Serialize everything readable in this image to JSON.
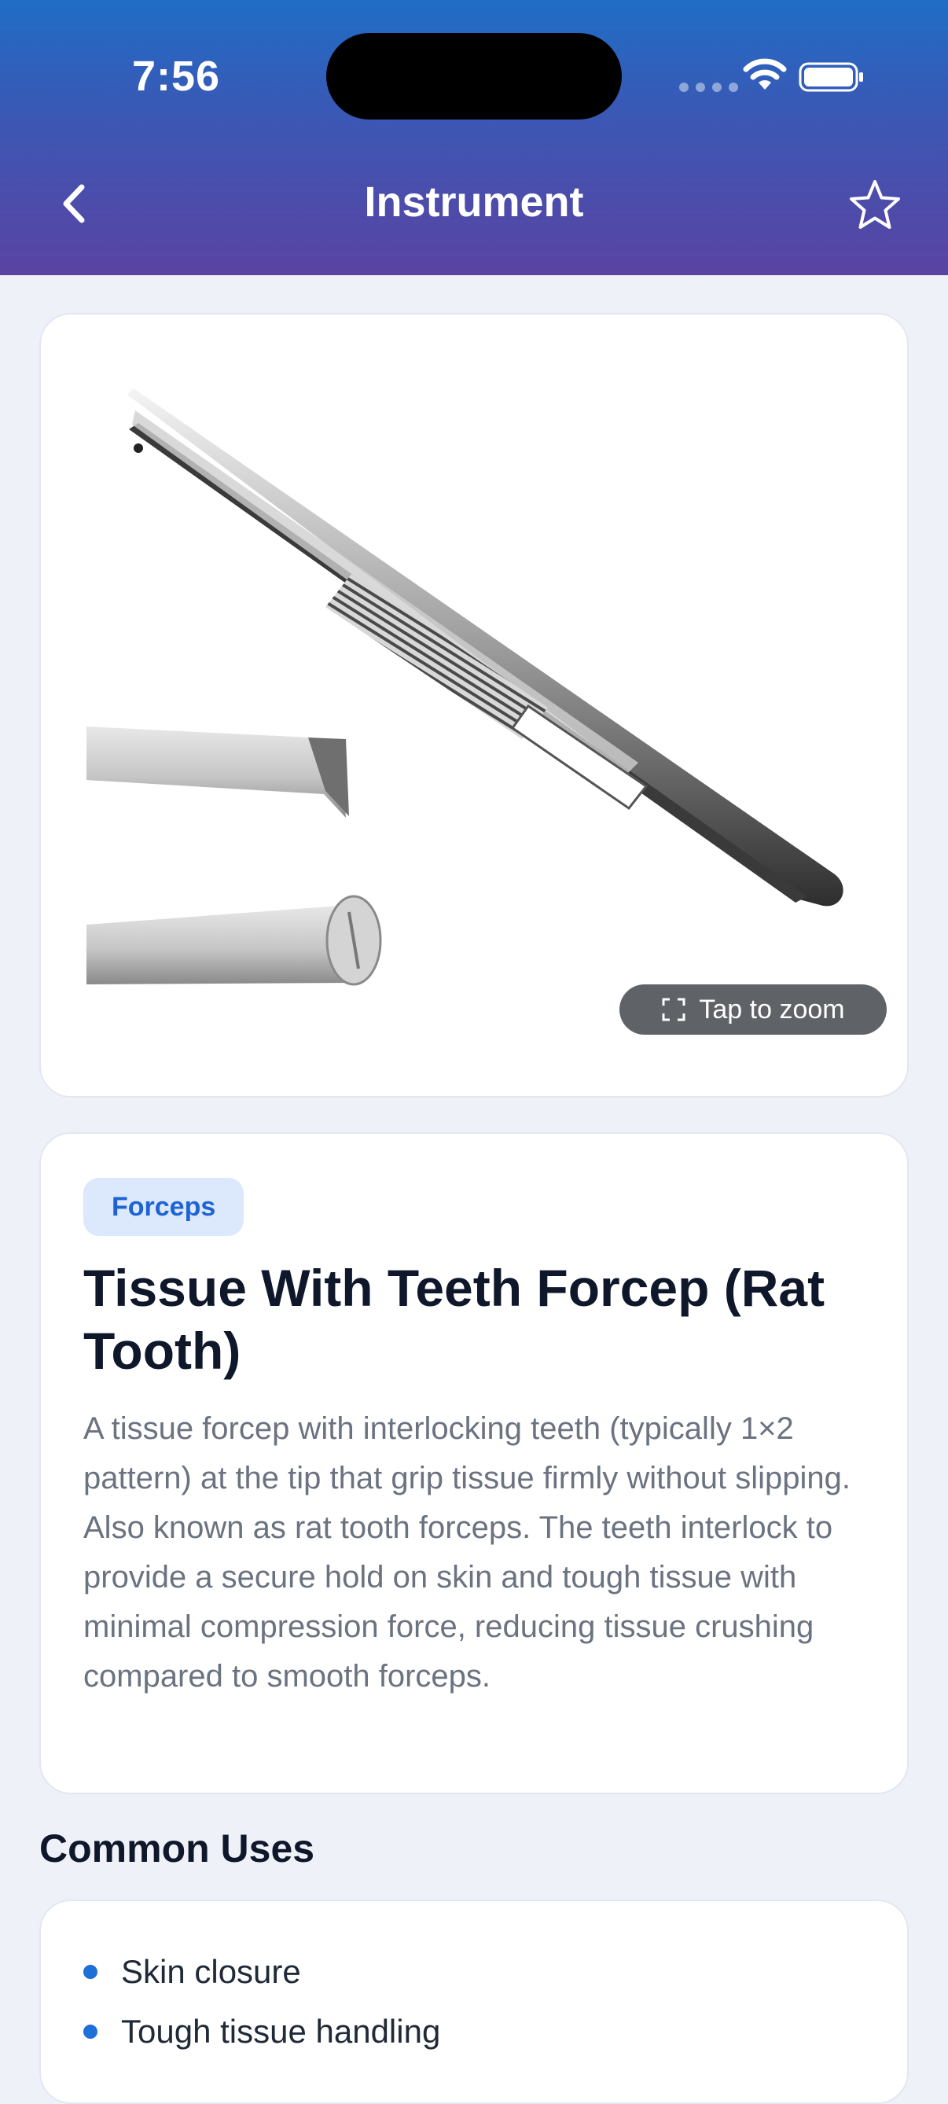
{
  "status_bar": {
    "time": "7:56"
  },
  "nav": {
    "title": "Instrument",
    "back_icon": "chevron-left-icon",
    "favorite_icon": "star-outline-icon"
  },
  "image": {
    "zoom_hint": "Tap to zoom",
    "zoom_icon": "expand-icon"
  },
  "instrument": {
    "category": "Forceps",
    "name": "Tissue With Teeth Forcep (Rat Tooth)",
    "description": "A tissue forcep with interlocking teeth (typically 1×2 pattern) at the tip that grip tissue firmly without slipping. Also known as rat tooth forceps. The teeth interlock to provide a secure hold on skin and tough tissue with minimal compression force, reducing tissue crushing compared to smooth forceps."
  },
  "common_uses": {
    "heading": "Common Uses",
    "items": [
      "Skin closure",
      "Tough tissue handling"
    ]
  },
  "colors": {
    "accent": "#1e63d3",
    "header_top": "#1f6dc6",
    "header_bottom": "#5a43a3"
  }
}
